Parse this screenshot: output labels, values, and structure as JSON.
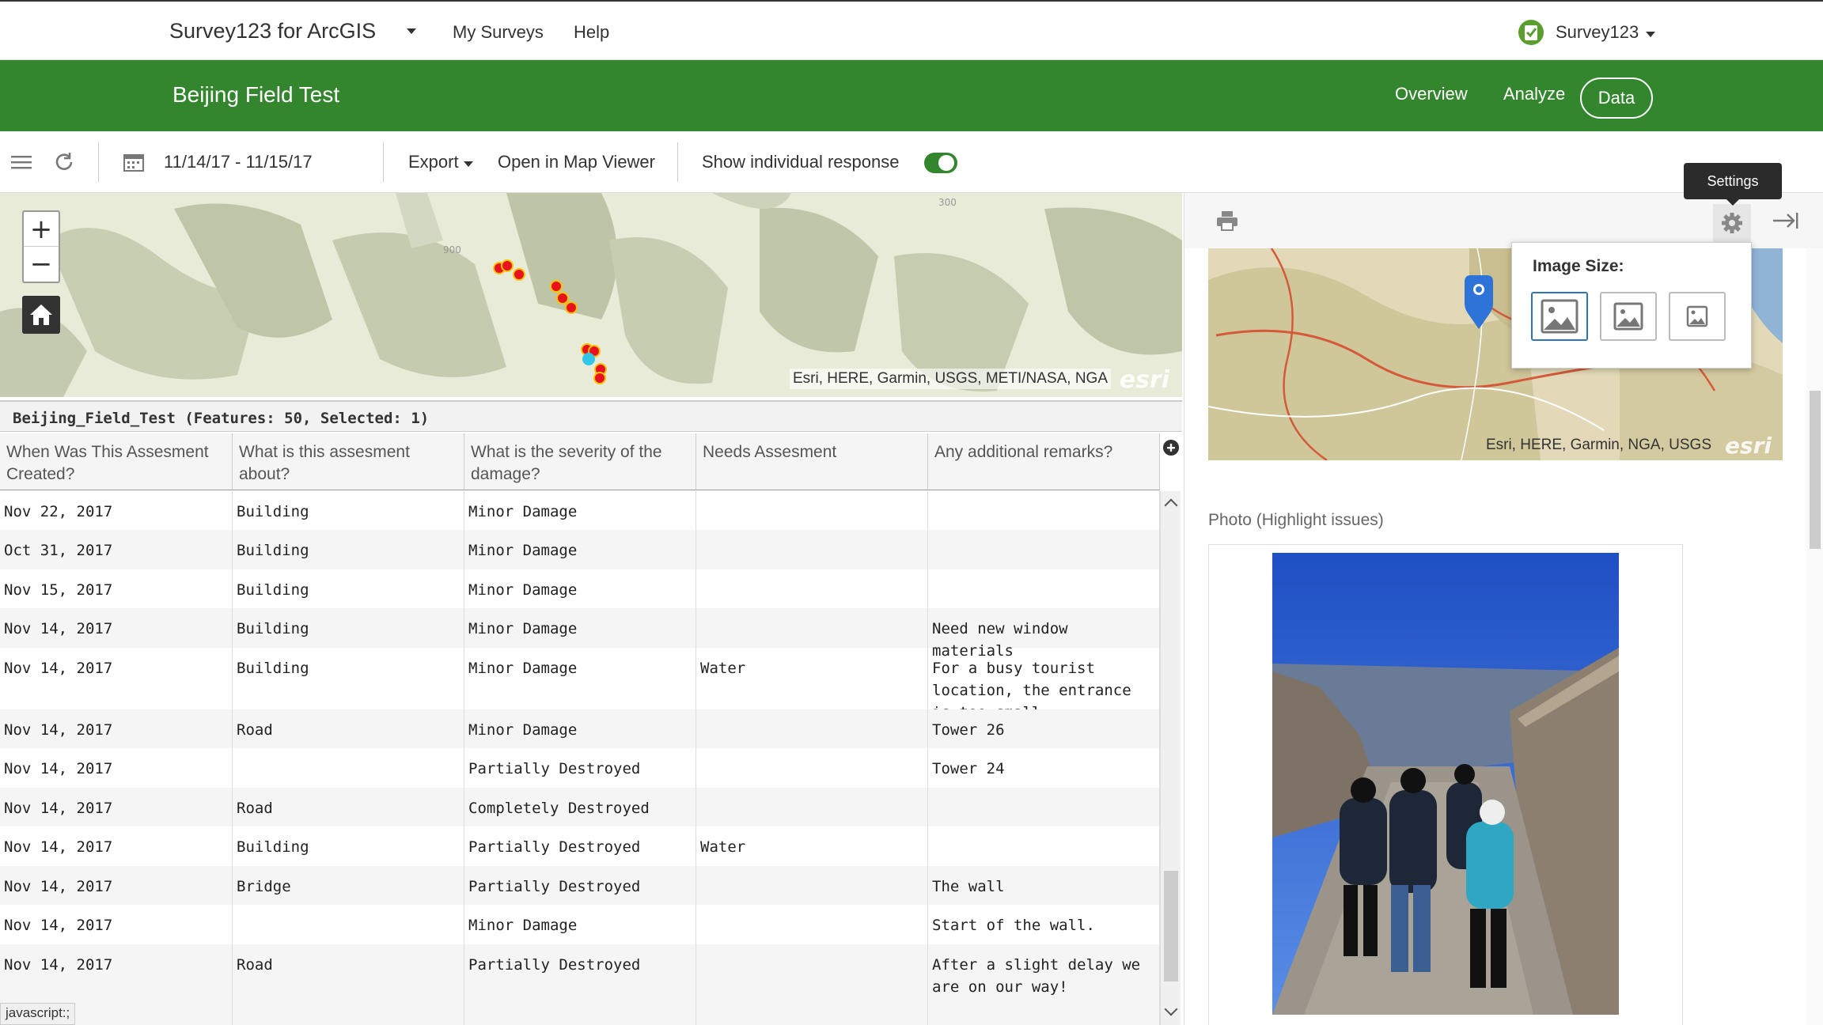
{
  "header": {
    "app_title": "Survey123 for ArcGIS",
    "nav": {
      "my_surveys": "My Surveys",
      "help": "Help"
    },
    "user": "Survey123"
  },
  "survey_bar": {
    "title": "Beijing Field Test",
    "tabs": {
      "overview": "Overview",
      "analyze": "Analyze",
      "data": "Data"
    },
    "active_tab": "Data"
  },
  "toolbar": {
    "date_range": "11/14/17 - 11/15/17",
    "export": "Export",
    "open_map": "Open in Map Viewer",
    "show_individual": "Show individual response",
    "show_individual_on": true
  },
  "map": {
    "attribution": "Esri, HERE, Garmin, USGS, METI/NASA, NGA",
    "logo": "esri",
    "contour_label_1": "900",
    "contour_label_2": "300"
  },
  "table": {
    "title": "Beijing_Field_Test (Features: 50, Selected: 1)",
    "columns": [
      "When Was This Assesment Created?",
      "What is this assesment about?",
      "What is the severity of the damage?",
      "Needs Assesment",
      "Any additional remarks?"
    ],
    "rows": [
      [
        "Nov 22, 2017",
        "Building",
        "Minor Damage",
        "",
        ""
      ],
      [
        "Oct 31, 2017",
        "Building",
        "Minor Damage",
        "",
        ""
      ],
      [
        "Nov 15, 2017",
        "Building",
        "Minor Damage",
        "",
        ""
      ],
      [
        "Nov 14, 2017",
        "Building",
        "Minor Damage",
        "",
        "Need new window materials"
      ],
      [
        "Nov 14, 2017",
        "Building",
        "Minor Damage",
        "Water",
        "For a busy tourist location, the entrance is too small"
      ],
      [
        "Nov 14, 2017",
        "Road",
        "Minor Damage",
        "",
        "Tower 26"
      ],
      [
        "Nov 14, 2017",
        "",
        "Partially Destroyed",
        "",
        "Tower 24"
      ],
      [
        "Nov 14, 2017",
        "Road",
        "Completely Destroyed",
        "",
        ""
      ],
      [
        "Nov 14, 2017",
        "Building",
        "Partially Destroyed",
        "Water",
        ""
      ],
      [
        "Nov 14, 2017",
        "Bridge",
        "Partially Destroyed",
        "",
        "The wall"
      ],
      [
        "Nov 14, 2017",
        "",
        "Minor Damage",
        "",
        "Start of the wall."
      ],
      [
        "Nov 14, 2017",
        "Road",
        "Partially Destroyed",
        "",
        "After a slight delay we are on our way!"
      ]
    ]
  },
  "status_bar": "javascript:;",
  "right_panel": {
    "minimap_attribution": "Esri, HERE, Garmin, NGA, USGS",
    "minimap_logo": "esri",
    "photo_label": "Photo (Highlight issues)",
    "settings_tooltip": "Settings",
    "image_size_label": "Image Size:",
    "selected_image_size": "large"
  },
  "colors": {
    "brand_green": "#33862e",
    "point_red": "#e8121f",
    "point_yellow": "#f6c300",
    "selected_blue": "#2e74b5"
  }
}
